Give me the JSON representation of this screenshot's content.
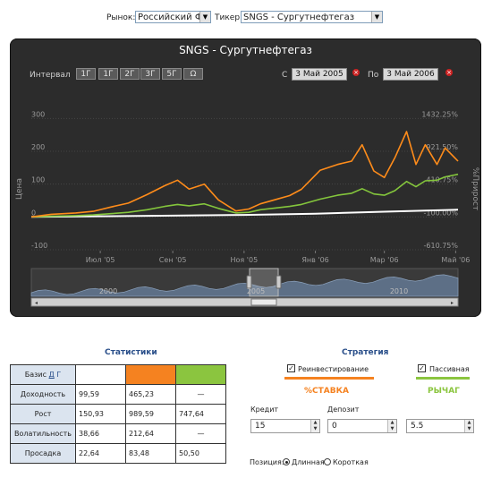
{
  "controls": {
    "market_label": "Рынок:",
    "market_value": "Российский ФР",
    "ticker_label": "Тикер:",
    "ticker_value": "SNGS - Сургутнефтегаз"
  },
  "chart_panel": {
    "title": "SNGS - Сургутнефтегаз",
    "interval_label": "Интервал",
    "interval_buttons": [
      "1Г",
      "1Г",
      "2Г",
      "3Г",
      "5Г",
      "Ω"
    ],
    "from_label": "С",
    "from_date": "3 Май 2005",
    "to_label": "По",
    "to_date": "3 Май 2006",
    "remove_glyph": "×"
  },
  "chart_data": {
    "type": "line",
    "ylabel_left": "Цена",
    "ylabel_right": "%Прирост",
    "yticks_left": [
      "300",
      "200",
      "100",
      "0",
      "-100"
    ],
    "yticks_right": [
      "1432.25%",
      "921.50%",
      "410.75%",
      "-100.00%",
      "-610.75%"
    ],
    "ylim_left": [
      -100,
      320
    ],
    "xticks": [
      "Июл '05",
      "Сен '05",
      "Ноя '05",
      "Янв '06",
      "Мар '06",
      "Май '06"
    ],
    "x_range": [
      "2005-05-03",
      "2006-05-03"
    ],
    "series": [
      {
        "color": "#ff8c1a",
        "x": [
          "2005-05-03",
          "2005-05-20",
          "2005-06-10",
          "2005-06-25",
          "2005-07-10",
          "2005-07-25",
          "2005-08-10",
          "2005-08-25",
          "2005-09-05",
          "2005-09-15",
          "2005-09-28",
          "2005-10-10",
          "2005-10-25",
          "2005-11-05",
          "2005-11-15",
          "2005-11-30",
          "2005-12-10",
          "2005-12-20",
          "2006-01-05",
          "2006-01-20",
          "2006-02-01",
          "2006-02-10",
          "2006-02-20",
          "2006-03-01",
          "2006-03-10",
          "2006-03-20",
          "2006-03-28",
          "2006-04-05",
          "2006-04-15",
          "2006-04-22",
          "2006-05-03"
        ],
        "values": [
          0,
          8,
          12,
          17,
          30,
          42,
          68,
          95,
          112,
          85,
          100,
          52,
          18,
          24,
          40,
          55,
          65,
          84,
          142,
          160,
          170,
          220,
          140,
          120,
          180,
          260,
          160,
          220,
          160,
          210,
          170
        ]
      },
      {
        "color": "#84c63c",
        "x": [
          "2005-05-03",
          "2005-05-20",
          "2005-06-10",
          "2005-06-25",
          "2005-07-10",
          "2005-07-25",
          "2005-08-10",
          "2005-08-25",
          "2005-09-05",
          "2005-09-15",
          "2005-09-28",
          "2005-10-10",
          "2005-10-25",
          "2005-11-05",
          "2005-11-15",
          "2005-11-30",
          "2005-12-10",
          "2005-12-20",
          "2006-01-05",
          "2006-01-20",
          "2006-02-01",
          "2006-02-10",
          "2006-02-20",
          "2006-03-01",
          "2006-03-10",
          "2006-03-20",
          "2006-03-28",
          "2006-04-05",
          "2006-04-15",
          "2006-04-22",
          "2006-05-03"
        ],
        "values": [
          0,
          2,
          4,
          6,
          10,
          14,
          22,
          32,
          38,
          34,
          40,
          26,
          12,
          14,
          22,
          28,
          32,
          38,
          54,
          66,
          72,
          86,
          70,
          66,
          80,
          108,
          92,
          110,
          112,
          122,
          130
        ]
      },
      {
        "color": "#ffffff",
        "x": [
          "2005-05-03",
          "2005-07-01",
          "2005-09-01",
          "2005-11-01",
          "2006-01-01",
          "2006-03-01",
          "2006-05-03"
        ],
        "values": [
          0,
          2,
          4,
          6,
          10,
          16,
          22
        ]
      }
    ],
    "navigator": {
      "labels": [
        "2000",
        "2005",
        "2010"
      ]
    }
  },
  "stats": {
    "title": "Статистики",
    "basis_label": "Базис",
    "basis_toggle": [
      "Д",
      "Г"
    ],
    "swatch_colors": [
      "#ffffff",
      "#f58220",
      "#8bc53f"
    ],
    "rows": [
      {
        "label": "Доходность",
        "values": [
          "99,59",
          "465,23",
          "—"
        ]
      },
      {
        "label": "Рост",
        "values": [
          "150,93",
          "989,59",
          "747,64"
        ]
      },
      {
        "label": "Волатильность",
        "values": [
          "38,66",
          "212,64",
          "—"
        ]
      },
      {
        "label": "Просадка",
        "values": [
          "22,64",
          "83,48",
          "50,50"
        ]
      }
    ]
  },
  "strategy": {
    "title": "Стратегия",
    "reinvest_label": "Реинвестирование",
    "passive_label": "Пассивная",
    "rate_heading": "%СТАВКА",
    "leverage_heading": "РЫЧАГ",
    "credit_label": "Кредит",
    "deposit_label": "Депозит",
    "credit_value": "15",
    "deposit_value": "0",
    "leverage_value": "5.5",
    "position_label": "Позиция:",
    "long_label": "Длинная",
    "short_label": "Короткая",
    "orange_color": "#f58220",
    "green_color": "#8bc53f"
  }
}
